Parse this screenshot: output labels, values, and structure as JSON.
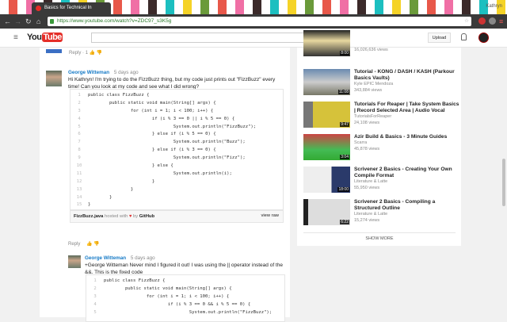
{
  "browser": {
    "tab_title": "Basics for Technical In",
    "user": "Kathryn",
    "url": "https://www.youtube.com/watch?v=ZDC97_s3K5g"
  },
  "header": {
    "logo_you": "You",
    "logo_tube": "Tube",
    "upload": "Upload"
  },
  "reply_row": {
    "reply": "Reply",
    "dot": "·",
    "likes": "1"
  },
  "comment1": {
    "author": "George Witteman",
    "time": "5 days ago",
    "text": "Hi Kathryn! I'm trying to do the FizzBuzz thing, but my code just prints out \"FizzBuzz\" every time! Can you look at my code and see what I did wrong?",
    "code": [
      "public class FizzBuzz {",
      "        public static void main(String[] args) {",
      "                for (int i = 1; i < 100; i++) {",
      "                        if (i % 3 == 0 || i % 5 == 0) {",
      "                                System.out.println(\"FizzBuzz\");",
      "                        } else if (i % 5 == 0) {",
      "                                System.out.println(\"Buzz\");",
      "                        } else if (i % 3 == 0) {",
      "                                System.out.println(\"Fizz\");",
      "                        } else {",
      "                                System.out.println(i);",
      "                        }",
      "                }",
      "        }",
      "}"
    ],
    "gist_file": "FizzBuzz.java",
    "gist_hosted": "hosted with",
    "gist_by": "by",
    "gist_github": "GitHub",
    "view_raw": "view raw",
    "reply": "Reply"
  },
  "comment2": {
    "author": "George Witteman",
    "time": "5 days ago",
    "text": "+George Witteman Never mind I figured it out! I was using the || operator instead of the &&. This is the fixed code",
    "code": [
      "public class FizzBuzz {",
      "        public static void main(String[] args) {",
      "                for (int i = 1; i < 100; i++) {",
      "                        if (i % 3 == 0 && i % 5 == 0) {",
      "                                System.out.println(\"FizzBuzz\");"
    ]
  },
  "sidebar": {
    "videos": [
      {
        "title": "",
        "channel": "",
        "views": "16,026,636 views",
        "duration": "8:00"
      },
      {
        "title": "Tutorial - KONG / DASH / KASH (Parkour Basics Vaults)",
        "channel": "Kyle EPIC Mendoza",
        "views": "343,884 views",
        "duration": "11:08"
      },
      {
        "title": "Tutorials For Reaper | Take System Basics | Record Selected Area | Audio Vocal",
        "channel": "TutorialsForReaper",
        "views": "24,108 views",
        "duration": "9:47"
      },
      {
        "title": "Azir Build & Basics - 3 Minute Guides",
        "channel": "Scarra",
        "views": "45,878 views",
        "duration": "3:04"
      },
      {
        "title": "Scrivener 2 Basics - Creating Your Own Compile Format",
        "channel": "Literature & Latte",
        "views": "55,950 views",
        "duration": "18:00"
      },
      {
        "title": "Scrivener 2 Basics - Compiling a Structured Outline",
        "channel": "Literature & Latte",
        "views": "15,274 views",
        "duration": "6:22"
      }
    ],
    "show_more": "SHOW MORE"
  },
  "colors": {
    "link": "#167ac6",
    "youtube_red": "#e52d27"
  }
}
